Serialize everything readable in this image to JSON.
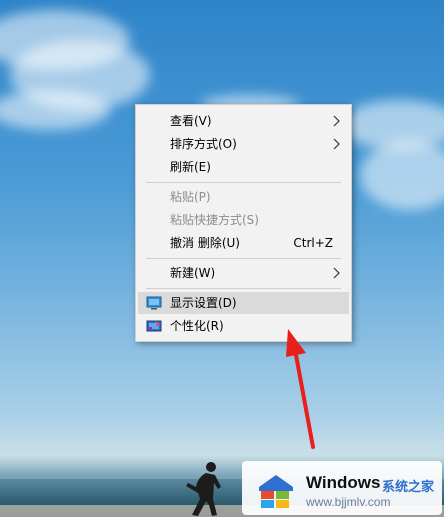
{
  "context_menu": {
    "items": [
      {
        "label": "查看(V)",
        "has_submenu": true
      },
      {
        "label": "排序方式(O)",
        "has_submenu": true
      },
      {
        "label": "刷新(E)"
      },
      {
        "label": "粘贴(P)",
        "disabled": true
      },
      {
        "label": "粘贴快捷方式(S)",
        "disabled": true
      },
      {
        "label": "撤消 删除(U)",
        "shortcut": "Ctrl+Z"
      },
      {
        "label": "新建(W)",
        "has_submenu": true
      },
      {
        "label": "显示设置(D)",
        "icon": "display-icon",
        "highlighted": true
      },
      {
        "label": "个性化(R)",
        "icon": "personalize-icon"
      }
    ]
  },
  "watermark": {
    "brand": "Windows",
    "brand_suffix": "系统之家",
    "url": "www.bjjmlv.com"
  }
}
